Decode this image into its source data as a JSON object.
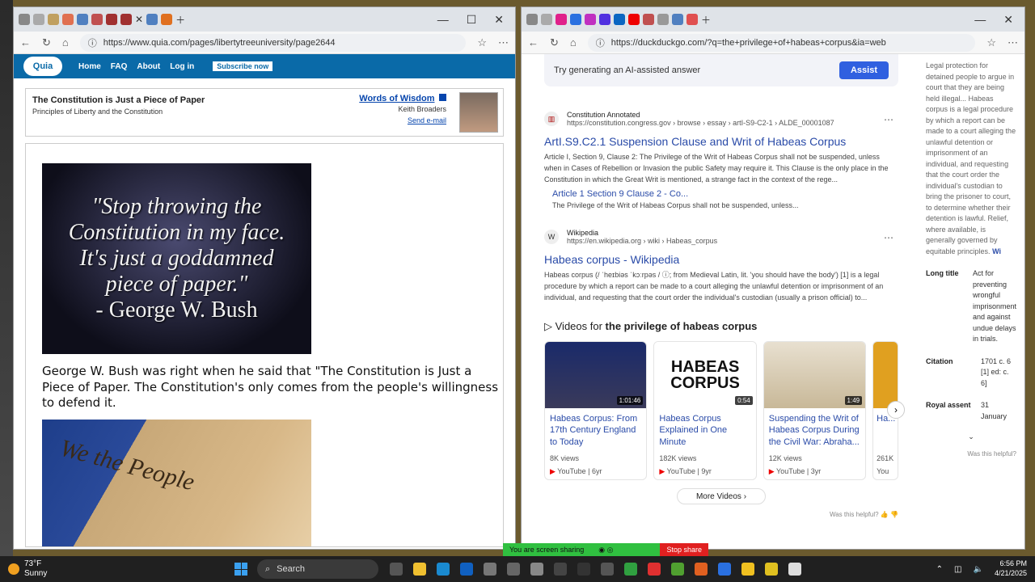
{
  "left": {
    "url": "https://www.quia.com/pages/libertytreeuniversity/page2644",
    "nav": {
      "logo": "Quia",
      "items": [
        "Home",
        "FAQ",
        "About",
        "Log in"
      ],
      "subscribe": "Subscribe now"
    },
    "header": {
      "title": "The Constitution is Just a Piece of Paper",
      "subtitle": "Principles of Liberty and the Constitution",
      "words_of_wisdom": "Words of Wisdom",
      "author": "Keith Broaders",
      "email": "Send e-mail"
    },
    "quote_image": {
      "line1": "\"Stop throwing the",
      "line2": "Constitution in my face.",
      "line3": "It's just a goddamned",
      "line4": "piece of paper.\"",
      "line5": "- George W. Bush"
    },
    "paragraph": "George W. Bush was right when he said that \"The Constitution is Just a Piece of Paper. The Constitution's only comes from the people's willingness to defend it.",
    "paper_image_text": "We the People"
  },
  "right": {
    "url": "https://duckduckgo.com/?q=the+privilege+of+habeas+corpus&ia=web",
    "ai_prompt": "Try generating an AI-assisted answer",
    "assist_label": "Assist",
    "results": [
      {
        "source": "Constitution Annotated",
        "url": "https://constitution.congress.gov › browse › essay › artI-S9-C2-1 › ALDE_00001087",
        "title": "ArtI.S9.C2.1 Suspension Clause and Writ of Habeas Corpus",
        "snippet": "Article I, Section 9, Clause 2: The Privilege of the Writ of Habeas Corpus shall not be suspended, unless when in Cases of Rebellion or Invasion the public Safety may require it. This Clause is the only place in the Constitution in which the Great Writ is mentioned, a strange fact in the context of the rege...",
        "sub_title": "Article 1 Section 9 Clause 2 - Co...",
        "sub_snippet": "The Privilege of the Writ of Habeas Corpus shall not be suspended, unless..."
      },
      {
        "source": "Wikipedia",
        "url": "https://en.wikipedia.org › wiki › Habeas_corpus",
        "title": "Habeas corpus - Wikipedia",
        "snippet": "Habeas corpus (/ ˈheɪbiəs ˈkɔːrpəs / ⓘ; from Medieval Latin, lit. 'you should have the body') [1] is a legal procedure by which a report can be made to a court alleging the unlawful detention or imprisonment of an individual, and requesting that the court order the individual's custodian (usually a prison official) to..."
      }
    ],
    "videos_heading_prefix": "Videos for",
    "videos_heading_query": "the privilege of habeas corpus",
    "videos": [
      {
        "title": "Habeas Corpus: From 17th Century England to Today",
        "duration": "1:01:46",
        "views": "8K views",
        "channel": "YouTube",
        "age": "6yr"
      },
      {
        "title": "Habeas Corpus Explained in One Minute",
        "duration": "0:54",
        "views": "182K views",
        "channel": "YouTube",
        "age": "9yr",
        "thumb_text": "HABEAS CORPUS"
      },
      {
        "title": "Suspending the Writ of Habeas Corpus During the Civil War: Abraha...",
        "duration": "1:49",
        "views": "12K views",
        "channel": "YouTube",
        "age": "3yr"
      },
      {
        "title": "Ha...",
        "views": "261K",
        "channel": "You"
      }
    ],
    "more_videos": "More Videos",
    "was_helpful": "Was this helpful?",
    "knowledge_panel": {
      "text": "Legal protection for detained people to argue in court that they are being held illegal... Habeas corpus is a legal procedure by which a report can be made to a court alleging the unlawful detention or imprisonment of an individual, and requesting that the court order the individual's custodian to bring the prisoner to court, to determine whether their detention is lawful. Relief, where available, is generally governed by equitable principles.",
      "wiki_link": "Wi",
      "rows": [
        {
          "k": "Long title",
          "v": "Act for preventing wrongful imprisonment and against undue delays in trials."
        },
        {
          "k": "Citation",
          "v": "1701 c. 6 [1] ed: c. 6]"
        },
        {
          "k": "Royal assent",
          "v": "31 January"
        }
      ],
      "helpful": "Was this helpful?"
    }
  },
  "sharebar": {
    "text": "You are screen sharing",
    "stop": "Stop share"
  },
  "taskbar": {
    "weather_temp": "73°F",
    "weather_desc": "Sunny",
    "search_label": "Search",
    "time": "6:56 PM",
    "date": "4/21/2025"
  }
}
